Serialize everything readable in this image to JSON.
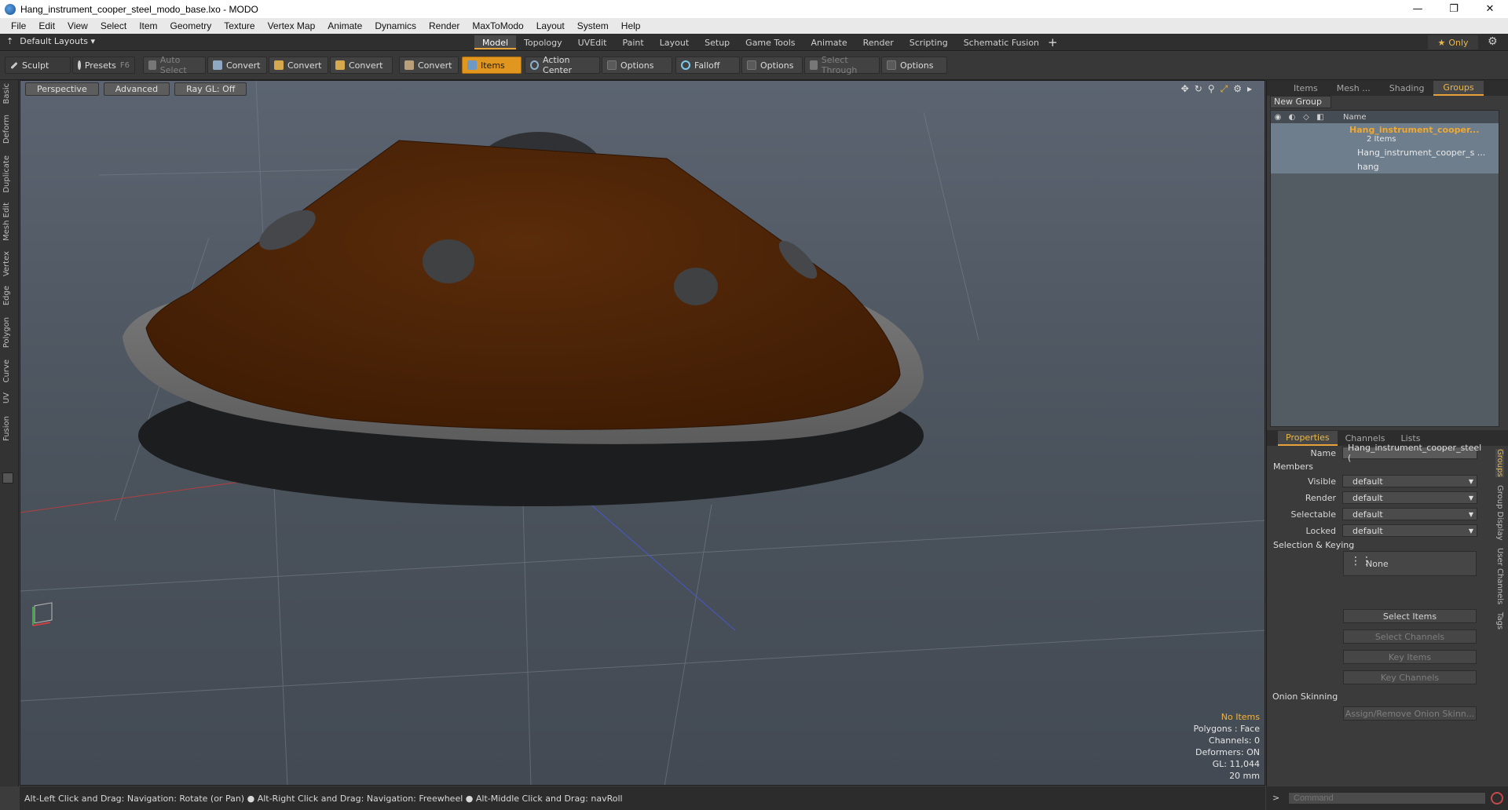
{
  "window": {
    "title": "Hang_instrument_cooper_steel_modo_base.lxo - MODO",
    "minimize": "—",
    "maximize": "❐",
    "close": "✕"
  },
  "menu": [
    "File",
    "Edit",
    "View",
    "Select",
    "Item",
    "Geometry",
    "Texture",
    "Vertex Map",
    "Animate",
    "Dynamics",
    "Render",
    "MaxToModo",
    "Layout",
    "System",
    "Help"
  ],
  "layouts": {
    "label": "Default Layouts ▾"
  },
  "mode_tabs": [
    "Model",
    "Topology",
    "UVEdit",
    "Paint",
    "Layout",
    "Setup",
    "Game Tools",
    "Animate",
    "Render",
    "Scripting",
    "Schematic Fusion"
  ],
  "active_mode": "Model",
  "only_label": "Only",
  "toolbar": {
    "sculpt": "Sculpt",
    "presets": "Presets",
    "presets_key": "F6",
    "auto_select": "Auto Select",
    "convert1": "Convert",
    "convert2": "Convert",
    "convert3": "Convert",
    "convert4": "Convert",
    "items": "Items",
    "action_center": "Action Center",
    "options1": "Options",
    "falloff": "Falloff",
    "options2": "Options",
    "select_through": "Select Through",
    "options3": "Options"
  },
  "left_tabs": [
    "Basic",
    "Deform",
    "Duplicate",
    "Mesh Edit",
    "Vertex",
    "Edge",
    "Polygon",
    "Curve",
    "UV",
    "Fusion"
  ],
  "viewport": {
    "view": "Perspective",
    "shading": "Advanced",
    "raygl": "Ray GL: Off",
    "info": {
      "selection": "No Items",
      "polygons": "Polygons : Face",
      "channels": "Channels: 0",
      "deformers": "Deformers: ON",
      "gl": "GL: 11,044",
      "scale": "20 mm"
    }
  },
  "status": "Alt-Left Click and Drag: Navigation: Rotate (or Pan) ● Alt-Right Click and Drag: Navigation: Freewheel ● Alt-Middle Click and Drag: navRoll",
  "right_tabs": [
    "Items",
    "Mesh ...",
    "Shading",
    "Groups"
  ],
  "active_right_tab": "Groups",
  "groups": {
    "new_group": "New Group",
    "column_name": "Name",
    "group_name": "Hang_instrument_cooper...",
    "group_count": "2 Items",
    "child1": "Hang_instrument_cooper_s ...",
    "child2": "hang"
  },
  "props_tabs": [
    "Properties",
    "Channels",
    "Lists"
  ],
  "properties": {
    "name_label": "Name",
    "name_value": "Hang_instrument_cooper_steel (",
    "members": "Members",
    "visible_label": "Visible",
    "visible_value": "default",
    "render_label": "Render",
    "render_value": "default",
    "selectable_label": "Selectable",
    "selectable_value": "default",
    "locked_label": "Locked",
    "locked_value": "default",
    "sel_keying": "Selection & Keying",
    "none": "None",
    "select_items": "Select Items",
    "select_channels": "Select Channels",
    "key_items": "Key Items",
    "key_channels": "Key Channels",
    "onion": "Onion Skinning",
    "assign_onion": "Assign/Remove Onion Skinn..."
  },
  "side_tabs": [
    "Groups",
    "Group Display",
    "User Channels",
    "Tags"
  ],
  "command": {
    "prompt": ">",
    "placeholder": "Command"
  },
  "colors": {
    "accent": "#e8a23a",
    "copper": "#5a2a08",
    "steel": "#6c6c6c"
  }
}
